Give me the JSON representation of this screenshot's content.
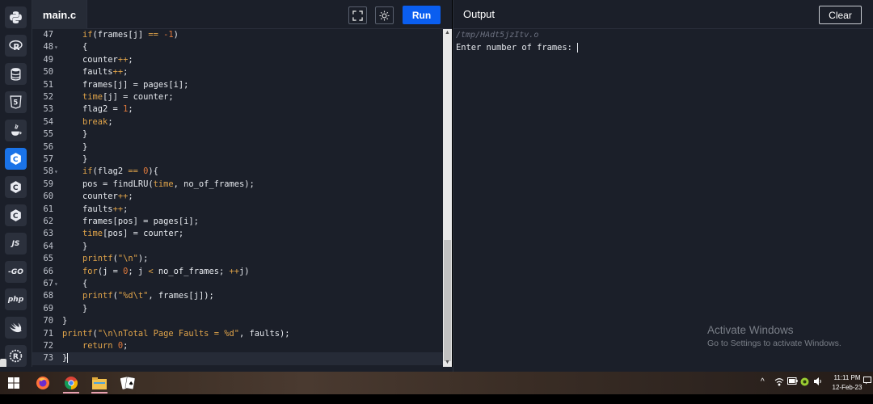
{
  "sidebar": {
    "languages": [
      {
        "name": "python-icon"
      },
      {
        "name": "r-icon"
      },
      {
        "name": "sql-icon"
      },
      {
        "name": "html5-icon"
      },
      {
        "name": "java-icon"
      },
      {
        "name": "c-icon",
        "active": true
      },
      {
        "name": "cpp-icon"
      },
      {
        "name": "csharp-icon"
      },
      {
        "name": "js-icon",
        "label": "JS"
      },
      {
        "name": "go-icon",
        "label": "-GO"
      },
      {
        "name": "php-icon",
        "label": "php"
      },
      {
        "name": "swift-icon"
      },
      {
        "name": "rust-icon"
      }
    ]
  },
  "editor": {
    "file_name": "main.c",
    "run_label": "Run",
    "fullscreen_icon": "fullscreen-icon",
    "theme_icon": "sun-icon"
  },
  "code": {
    "current_line": 73,
    "lines": [
      {
        "n": "47",
        "fold": false,
        "text": "    if(frames[j] == -1)"
      },
      {
        "n": "48",
        "fold": true,
        "text": "    {"
      },
      {
        "n": "49",
        "fold": false,
        "text": "    counter++;"
      },
      {
        "n": "50",
        "fold": false,
        "text": "    faults++;"
      },
      {
        "n": "51",
        "fold": false,
        "text": "    frames[j] = pages[i];"
      },
      {
        "n": "52",
        "fold": false,
        "text": "    time[j] = counter;"
      },
      {
        "n": "53",
        "fold": false,
        "text": "    flag2 = 1;"
      },
      {
        "n": "54",
        "fold": false,
        "text": "    break;"
      },
      {
        "n": "55",
        "fold": false,
        "text": "    }"
      },
      {
        "n": "56",
        "fold": false,
        "text": "    }"
      },
      {
        "n": "57",
        "fold": false,
        "text": "    }"
      },
      {
        "n": "58",
        "fold": true,
        "text": "    if(flag2 == 0){"
      },
      {
        "n": "59",
        "fold": false,
        "text": "    pos = findLRU(time, no_of_frames);"
      },
      {
        "n": "60",
        "fold": false,
        "text": "    counter++;"
      },
      {
        "n": "61",
        "fold": false,
        "text": "    faults++;"
      },
      {
        "n": "62",
        "fold": false,
        "text": "    frames[pos] = pages[i];"
      },
      {
        "n": "63",
        "fold": false,
        "text": "    time[pos] = counter;"
      },
      {
        "n": "64",
        "fold": false,
        "text": "    }"
      },
      {
        "n": "65",
        "fold": false,
        "text": "    printf(\"\\n\");"
      },
      {
        "n": "66",
        "fold": false,
        "text": "    for(j = 0; j < no_of_frames; ++j)"
      },
      {
        "n": "67",
        "fold": true,
        "text": "    {"
      },
      {
        "n": "68",
        "fold": false,
        "text": "    printf(\"%d\\t\", frames[j]);"
      },
      {
        "n": "69",
        "fold": false,
        "text": "    }"
      },
      {
        "n": "70",
        "fold": false,
        "text": "}"
      },
      {
        "n": "71",
        "fold": false,
        "text": "printf(\"\\n\\nTotal Page Faults = %d\", faults);"
      },
      {
        "n": "72",
        "fold": false,
        "text": "    return 0;"
      },
      {
        "n": "73",
        "fold": false,
        "text": "}"
      }
    ]
  },
  "output": {
    "title": "Output",
    "clear_label": "Clear",
    "path": "/tmp/HAdt5jzItv.o",
    "prompt": "Enter number of frames: "
  },
  "watermark": {
    "line1": "Activate Windows",
    "line2": "Go to Settings to activate Windows."
  },
  "taskbar": {
    "time": "11:11 PM",
    "date": "12-Feb-23",
    "apps": [
      "windows-start-icon",
      "firefox-icon",
      "chrome-icon",
      "file-explorer-icon",
      "solitaire-icon"
    ]
  },
  "colors": {
    "background": "#1b1f29",
    "accent": "#0a5ef0",
    "keyword": "#e0a44a",
    "number": "#e07a3c"
  }
}
